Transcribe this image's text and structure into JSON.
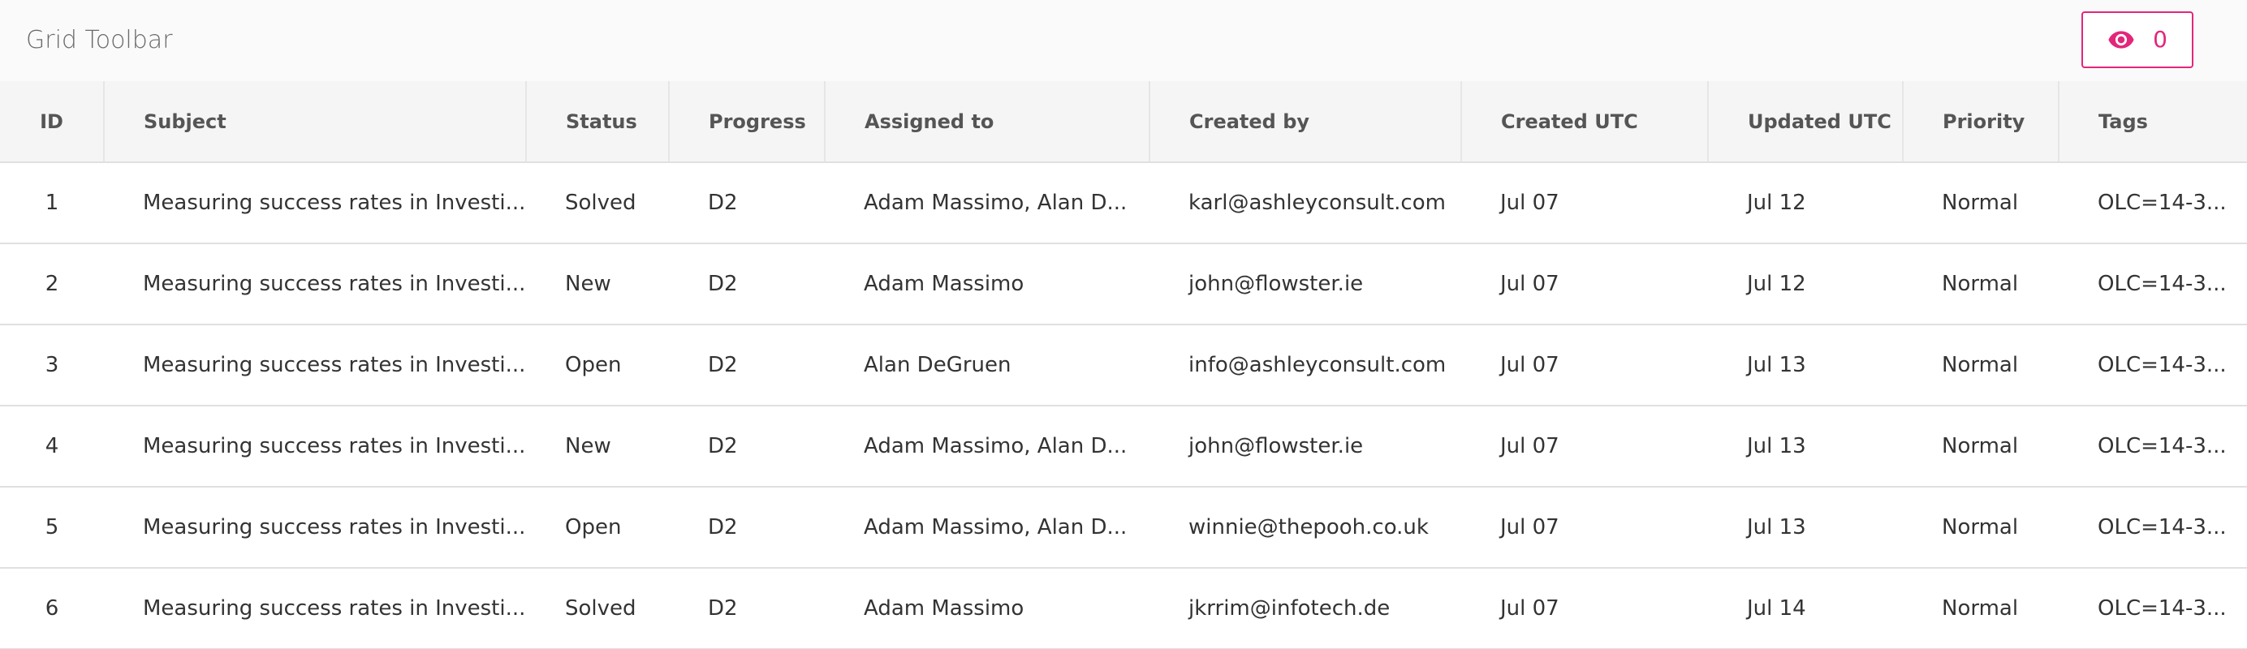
{
  "toolbar": {
    "title": "Grid Toolbar",
    "visibility_button": {
      "icon": "eye-icon",
      "count": "0",
      "accent_color": "#e3267a"
    }
  },
  "grid": {
    "columns": [
      {
        "key": "id",
        "label": "ID"
      },
      {
        "key": "subject",
        "label": "Subject"
      },
      {
        "key": "status",
        "label": "Status"
      },
      {
        "key": "progress",
        "label": "Progress"
      },
      {
        "key": "assigned_to",
        "label": "Assigned to"
      },
      {
        "key": "created_by",
        "label": "Created by"
      },
      {
        "key": "created_utc",
        "label": "Created UTC"
      },
      {
        "key": "updated_utc",
        "label": "Updated UTC"
      },
      {
        "key": "priority",
        "label": "Priority"
      },
      {
        "key": "tags",
        "label": "Tags"
      }
    ],
    "rows": [
      {
        "id": "1",
        "subject": "Measuring success rates in Investi...",
        "status": "Solved",
        "progress": "D2",
        "assigned_to": "Adam Massimo, Alan D...",
        "created_by": "karl@ashleyconsult.com",
        "created_utc": "Jul 07",
        "updated_utc": "Jul 12",
        "priority": "Normal",
        "tags": "OLC=14-3..."
      },
      {
        "id": "2",
        "subject": "Measuring success rates in Investi...",
        "status": "New",
        "progress": "D2",
        "assigned_to": "Adam Massimo",
        "created_by": "john@flowster.ie",
        "created_utc": "Jul 07",
        "updated_utc": "Jul 12",
        "priority": "Normal",
        "tags": "OLC=14-3..."
      },
      {
        "id": "3",
        "subject": "Measuring success rates in Investi...",
        "status": "Open",
        "progress": "D2",
        "assigned_to": "Alan DeGruen",
        "created_by": "info@ashleyconsult.com",
        "created_utc": "Jul 07",
        "updated_utc": "Jul 13",
        "priority": "Normal",
        "tags": "OLC=14-3..."
      },
      {
        "id": "4",
        "subject": "Measuring success rates in Investi...",
        "status": "New",
        "progress": "D2",
        "assigned_to": "Adam Massimo, Alan D...",
        "created_by": "john@flowster.ie",
        "created_utc": "Jul 07",
        "updated_utc": "Jul 13",
        "priority": "Normal",
        "tags": "OLC=14-3..."
      },
      {
        "id": "5",
        "subject": "Measuring success rates in Investi...",
        "status": "Open",
        "progress": "D2",
        "assigned_to": "Adam Massimo, Alan D...",
        "created_by": "winnie@thepooh.co.uk",
        "created_utc": "Jul 07",
        "updated_utc": "Jul 13",
        "priority": "Normal",
        "tags": "OLC=14-3..."
      },
      {
        "id": "6",
        "subject": "Measuring success rates in Investi...",
        "status": "Solved",
        "progress": "D2",
        "assigned_to": "Adam Massimo",
        "created_by": "jkrrim@infotech.de",
        "created_utc": "Jul 07",
        "updated_utc": "Jul 14",
        "priority": "Normal",
        "tags": "OLC=14-3..."
      }
    ]
  }
}
